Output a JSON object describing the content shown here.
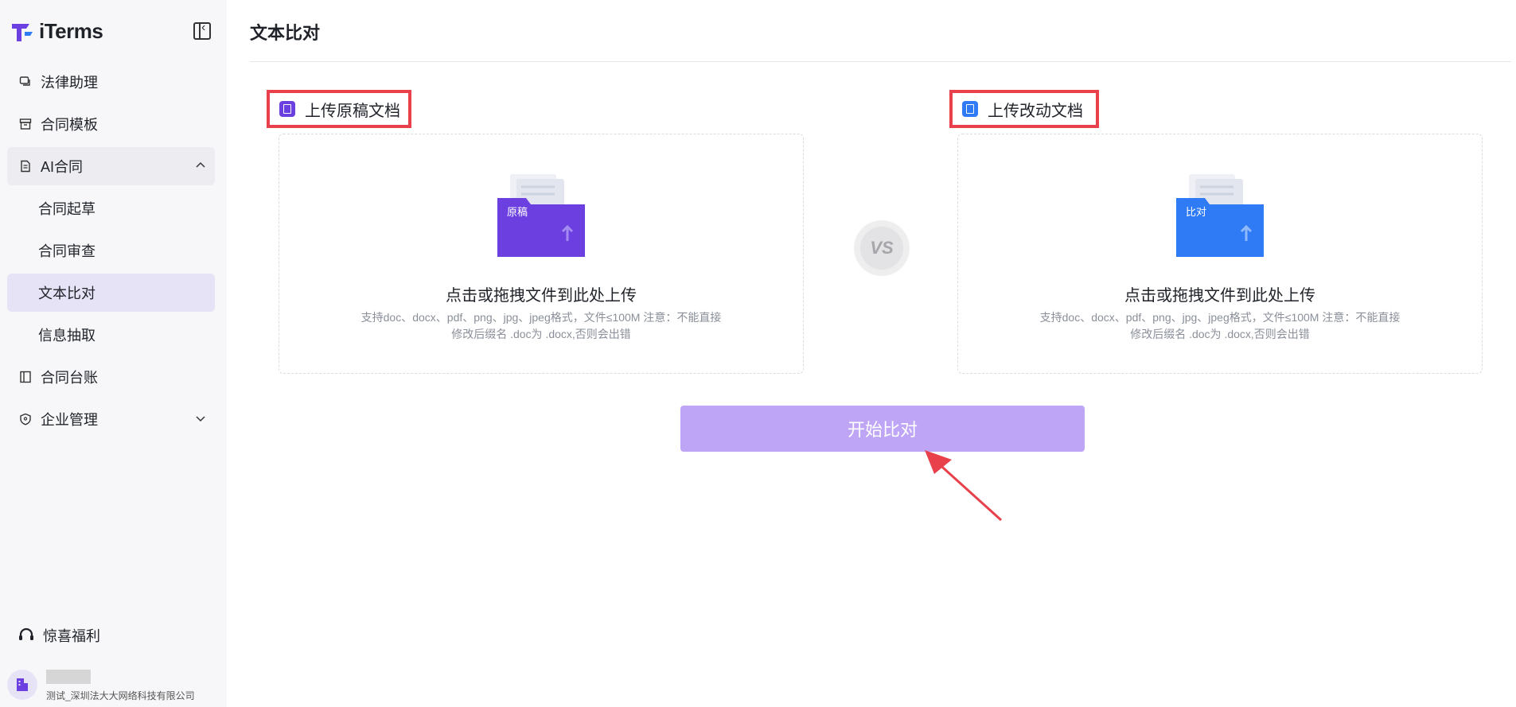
{
  "app": {
    "name": "iTerms"
  },
  "sidebar": {
    "items": [
      {
        "label": "法律助理"
      },
      {
        "label": "合同模板"
      },
      {
        "label": "AI合同"
      },
      {
        "label": "合同起草"
      },
      {
        "label": "合同审查"
      },
      {
        "label": "文本比对"
      },
      {
        "label": "信息抽取"
      },
      {
        "label": "合同台账"
      },
      {
        "label": "企业管理"
      }
    ],
    "welfare": "惊喜福利",
    "company": "测试_深圳法大大网络科技有限公司"
  },
  "page": {
    "title": "文本比对"
  },
  "original": {
    "label": "上传原稿文档",
    "folder_tag": "原稿",
    "title": "点击或拖拽文件到此处上传",
    "note": "支持doc、docx、pdf、png、jpg、jpeg格式，文件≤100M 注意：不能直接修改后缀名 .doc为 .docx,否则会出错",
    "color": "#6b3fe0"
  },
  "modified": {
    "label": "上传改动文档",
    "folder_tag": "比对",
    "title": "点击或拖拽文件到此处上传",
    "note": "支持doc、docx、pdf、png、jpg、jpeg格式，文件≤100M 注意：不能直接修改后缀名 .doc为 .docx,否则会出错",
    "color": "#2f7bf6"
  },
  "vs": "VS",
  "start_button": "开始比对",
  "colors": {
    "accent": "#bea5f6",
    "highlight": "#e8414b",
    "active_bg": "#e7e3f7"
  }
}
